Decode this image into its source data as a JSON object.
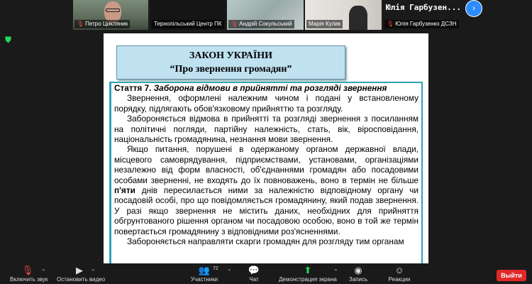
{
  "participants": [
    {
      "name": "Петро Цикляник",
      "muted": true
    },
    {
      "name": "Тернопільський Центр ПК",
      "muted": false
    },
    {
      "name": "Андрій Сокульський",
      "muted": true
    },
    {
      "name": "Марія Кулик",
      "muted": false
    },
    {
      "name": "Юлія Гарбузенко ДСЗН",
      "muted": true
    }
  ],
  "active_speaker": {
    "name": "Юлія Гарбузен..."
  },
  "slide": {
    "title_line1": "ЗАКОН УКРАЇНИ",
    "title_line2": "“Про звернення громадян”",
    "article_number": "Стаття 7.",
    "article_title": "Заборона відмови в прийнятті та розгляді звернення",
    "p1": "Звернення, оформлені належним чином і подані у встановленому порядку, підлягають обов'язковому прийняттю та розгляду.",
    "p2": "Забороняється відмова в прийнятті та розгляді звернення з посиланням на політичні погляди, партійну належність, стать, вік, віросповідання, національність громадянина, незнання мови звернення.",
    "p3_a": "Якщо питання, порушені в одержаному органом державної влади, місцевого самоврядування, підприємствами, установами, організаціями незалежно від форм власності, об'єднаннями громадян або посадовими особами зверненні, не входять до їх повноважень, воно в термін не більше ",
    "p3_bold": "п'яти",
    "p3_b": " днів пересилається ними за належністю відповідному органу чи посадовій особі, про що повідомляється громадянину, який подав звернення. У разі якщо звернення не містить даних, необхідних для прийняття обгрунтованого рішення органом чи посадовою особою, воно в той же термін повертається громадянину з відповідними роз'ясненнями.",
    "p4": "Забороняється направляти скарги громадян для розгляду тим органам"
  },
  "toolbar": {
    "mute_label": "Включить звук",
    "video_label": "Остановить видео",
    "participants_label": "Участники",
    "participants_count": "72",
    "chat_label": "Чат",
    "share_label": "Демонстрация экрана",
    "record_label": "Запись",
    "reactions_label": "Реакции",
    "leave_label": "Выйти"
  },
  "colors": {
    "accent": "#2d8cff",
    "leave": "#e02828",
    "share": "#23d959",
    "muted_mic": "#e8483c"
  }
}
